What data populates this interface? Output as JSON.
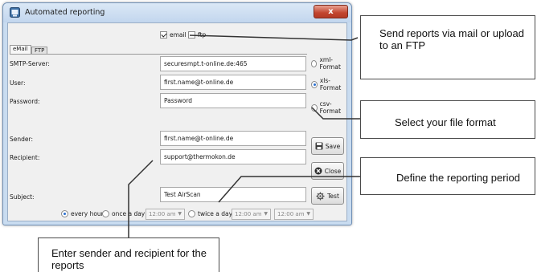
{
  "window": {
    "title": "Automated reporting",
    "close_label": "x"
  },
  "channels": {
    "email_label": "email",
    "email_checked": true,
    "ftp_label": "ftp",
    "ftp_checked": false
  },
  "tabs": [
    {
      "label": "eMail",
      "active": true
    },
    {
      "label": "FTP",
      "active": false
    }
  ],
  "fields": {
    "smtp_label": "SMTP-Server:",
    "smtp_value": "securesmpt.t-online.de:465",
    "user_label": "User:",
    "user_value": "first.name@t-online.de",
    "password_label": "Password:",
    "password_value": "Password",
    "sender_label": "Sender:",
    "sender_value": "first.name@t-online.de",
    "recipient_label": "Recipient:",
    "recipient_value": "support@thermokon.de",
    "subject_label": "Subject:",
    "subject_value": "Test AirScan"
  },
  "formats": [
    {
      "label": "xml-Format",
      "selected": false
    },
    {
      "label": "xls-Format",
      "selected": true
    },
    {
      "label": "csv-Format",
      "selected": false
    }
  ],
  "buttons": {
    "save": "Save",
    "close": "Close",
    "test": "Test"
  },
  "schedule": {
    "every_hour": "every hour",
    "once_a_day": "once a day",
    "twice_a_day": "twice a day",
    "selected": "every hour",
    "once_time": "12:00 am",
    "twice_time_1": "12:00 am",
    "twice_time_2": "12:00 am"
  },
  "callouts": {
    "send": "Send reports via mail or upload to an FTP",
    "format": "Select your file format",
    "period": "Define the reporting period",
    "sender": "Enter sender and recipient for the reports"
  },
  "colors": {
    "accent": "#2a6fcf",
    "close_button": "#c2452f",
    "window_frame": "#c9dcf0"
  }
}
